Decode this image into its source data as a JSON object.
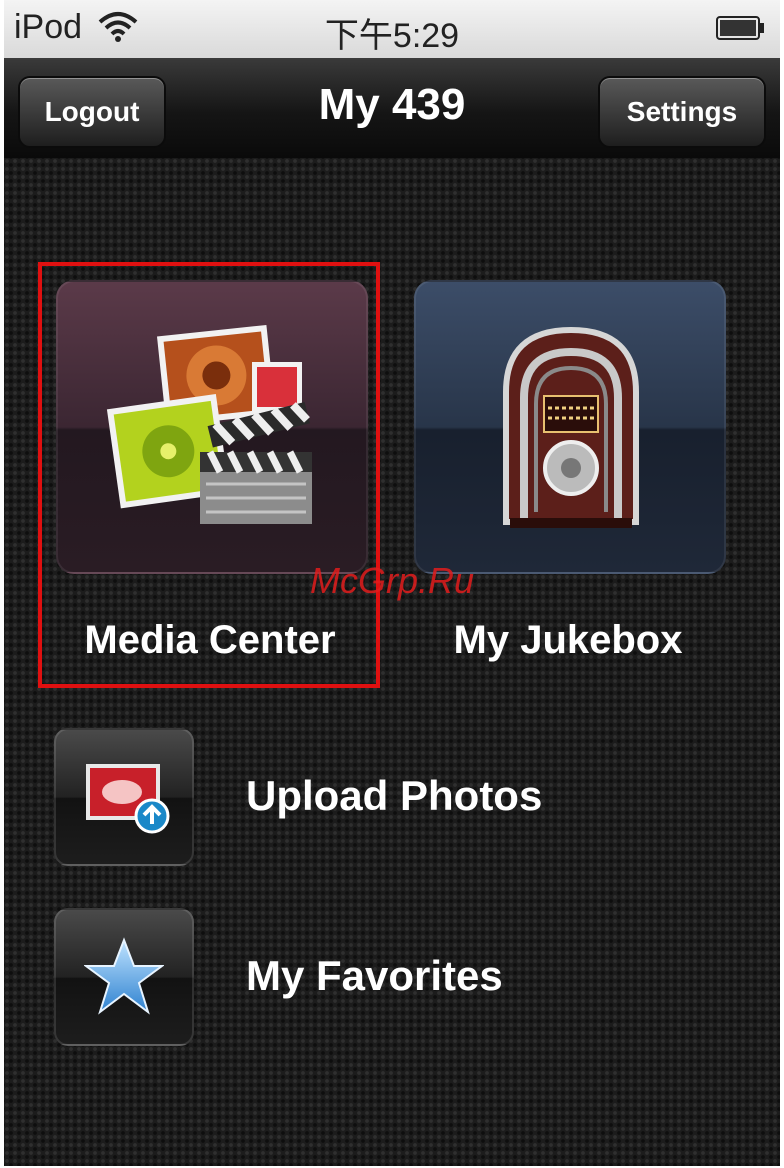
{
  "status_bar": {
    "device": "iPod",
    "time": "下午5:29"
  },
  "nav": {
    "title": "My 439",
    "logout_label": "Logout",
    "settings_label": "Settings"
  },
  "tiles": [
    {
      "label": "Media Center",
      "icon": "media-center-icon"
    },
    {
      "label": "My Jukebox",
      "icon": "jukebox-icon"
    }
  ],
  "rows": [
    {
      "label": "Upload Photos",
      "icon": "upload-photo-icon"
    },
    {
      "label": "My Favorites",
      "icon": "star-icon"
    }
  ],
  "watermark": "McGrp.Ru",
  "colors": {
    "highlight": "#e01010",
    "background": "#1c1c1c"
  }
}
